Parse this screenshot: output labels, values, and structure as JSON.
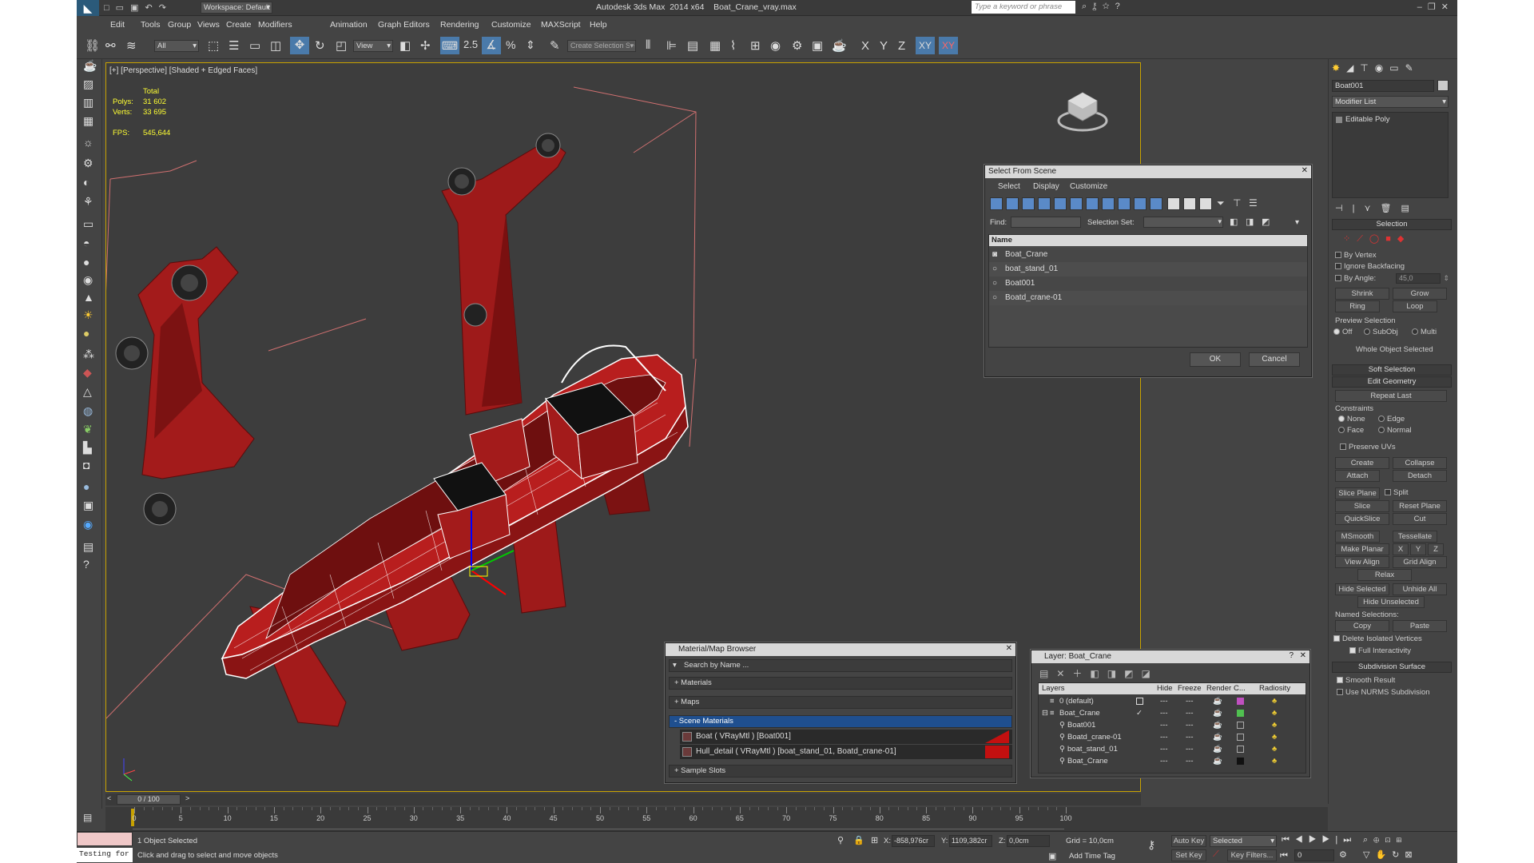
{
  "app": {
    "title": "Autodesk 3ds Max  2014 x64    Boat_Crane_vray.max",
    "workspace": "Workspace: Default",
    "search_placeholder": "Type a keyword or phrase"
  },
  "menu": [
    "Edit",
    "Tools",
    "Group",
    "Views",
    "Create",
    "Modifiers",
    "Animation",
    "Graph Editors",
    "Rendering",
    "Customize",
    "MAXScript",
    "Help"
  ],
  "toolbar": {
    "filter": "All",
    "ref_coord": "View",
    "selection_set": "Create Selection Se",
    "axes": [
      "X",
      "Y",
      "Z",
      "XY",
      "XY"
    ]
  },
  "viewport": {
    "label": "[+] [Perspective] [Shaded + Edged Faces]",
    "stats_header": "Total",
    "polys_label": "Polys:",
    "polys": "31 602",
    "verts_label": "Verts:",
    "verts": "33 695",
    "fps_label": "FPS:",
    "fps": "545,644"
  },
  "select_dialog": {
    "title": "Select From Scene",
    "menu": [
      "Select",
      "Display",
      "Customize"
    ],
    "find_label": "Find:",
    "selset_label": "Selection Set:",
    "col_name": "Name",
    "items": [
      "Boat_Crane",
      "boat_stand_01",
      "Boat001",
      "Boatd_crane-01"
    ],
    "ok": "OK",
    "cancel": "Cancel"
  },
  "material_browser": {
    "title": "Material/Map Browser",
    "search": "Search by Name ...",
    "sections": [
      "+ Materials",
      "+ Maps",
      "- Scene Materials"
    ],
    "materials": [
      "Boat  ( VRayMtl ) [Boat001]",
      "Hull_detail  ( VRayMtl ) [boat_stand_01, Boatd_crane-01]"
    ],
    "sample_slots": "+ Sample Slots"
  },
  "layer_dialog": {
    "title": "Layer: Boat_Crane",
    "columns": [
      "Layers",
      "Hide",
      "Freeze",
      "Render",
      "C...",
      "Radiosity"
    ],
    "rows": [
      {
        "name": "0 (default)",
        "indent": 0,
        "color": "#c050c0"
      },
      {
        "name": "Boat_Crane",
        "indent": 0,
        "color": "#50c050"
      },
      {
        "name": "Boat001",
        "indent": 1,
        "color": ""
      },
      {
        "name": "Boatd_crane-01",
        "indent": 1,
        "color": ""
      },
      {
        "name": "boat_stand_01",
        "indent": 1,
        "color": ""
      },
      {
        "name": "Boat_Crane",
        "indent": 1,
        "color": "#111111"
      }
    ]
  },
  "command_panel": {
    "object_name": "Boat001",
    "modifier_list": "Modifier List",
    "stack_item": "Editable Poly",
    "selection_head": "Selection",
    "by_vertex": "By Vertex",
    "ignore_backfacing": "Ignore Backfacing",
    "by_angle": "By Angle:",
    "angle_value": "45,0",
    "shrink": "Shrink",
    "grow": "Grow",
    "ring": "Ring",
    "loop": "Loop",
    "preview_selection": "Preview Selection",
    "preview_opts": [
      "Off",
      "SubObj",
      "Multi"
    ],
    "whole_object": "Whole Object Selected",
    "soft_selection": "Soft Selection",
    "edit_geometry": "Edit Geometry",
    "repeat_last": "Repeat Last",
    "constraints": "Constraints",
    "constraint_opts": [
      "None",
      "Edge",
      "Face",
      "Normal"
    ],
    "preserve_uvs": "Preserve UVs",
    "create": "Create",
    "collapse": "Collapse",
    "attach": "Attach",
    "detach": "Detach",
    "slice_plane": "Slice Plane",
    "split": "Split",
    "slice": "Slice",
    "reset_plane": "Reset Plane",
    "quickslice": "QuickSlice",
    "cut": "Cut",
    "msmooth": "MSmooth",
    "tessellate": "Tessellate",
    "make_planar": "Make Planar",
    "xyz": [
      "X",
      "Y",
      "Z"
    ],
    "view_align": "View Align",
    "grid_align": "Grid Align",
    "relax": "Relax",
    "hide_selected": "Hide Selected",
    "unhide_all": "Unhide All",
    "hide_unselected": "Hide Unselected",
    "named_selections": "Named Selections:",
    "copy": "Copy",
    "paste": "Paste",
    "delete_isolated": "Delete Isolated Vertices",
    "full_interactivity": "Full Interactivity",
    "subdivision_surface": "Subdivision Surface",
    "smooth_result": "Smooth Result",
    "use_nurms": "Use NURMS Subdivision"
  },
  "timeline": {
    "frame": "0 / 100",
    "ticks": [
      "0",
      "5",
      "10",
      "15",
      "20",
      "25",
      "30",
      "35",
      "40",
      "45",
      "50",
      "55",
      "60",
      "65",
      "70",
      "75",
      "80",
      "85",
      "90",
      "95",
      "100"
    ]
  },
  "status": {
    "maxscript": "Testing for :",
    "selected": "1 Object Selected",
    "prompt": "Click and drag to select and move objects",
    "x_label": "X:",
    "x": "-858,976cr",
    "y_label": "Y:",
    "y": "1109,382cr",
    "z_label": "Z:",
    "z": "0,0cm",
    "grid": "Grid = 10,0cm",
    "auto_key": "Auto Key",
    "set_key": "Set Key",
    "key_mode": "Selected",
    "key_filters": "Key Filters...",
    "add_time_tag": "Add Time Tag",
    "frame_field": "0"
  }
}
